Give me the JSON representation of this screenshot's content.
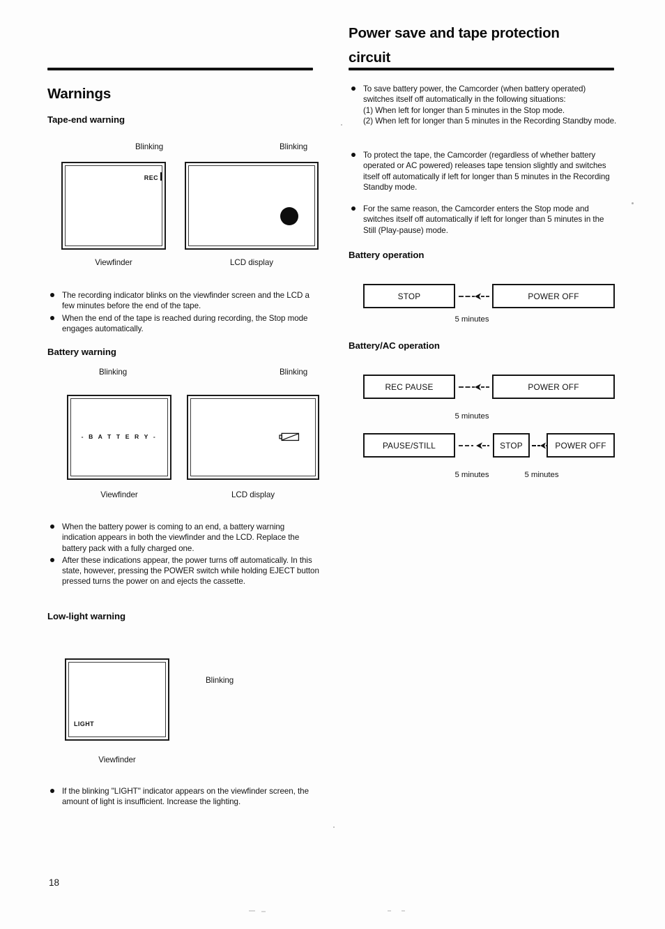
{
  "page": {
    "number": "18"
  },
  "left_column": {
    "heading": "Warnings",
    "sections": [
      {
        "title": "Tape-end warning",
        "figures": {
          "blinking_label_left": "Blinking",
          "blinking_label_right": "Blinking",
          "viewfinder_caption": "Viewfinder",
          "lcd_caption": "LCD display",
          "viewfinder_screen_text": "REC",
          "lcd_screen_icon": "record-dot-icon"
        },
        "bullets": [
          "The recording indicator blinks on the viewfinder screen and the LCD a few minutes before the end of the tape.",
          "When the end of the tape is reached during recording, the Stop mode engages automatically."
        ]
      },
      {
        "title": "Battery warning",
        "figures": {
          "blinking_label_left": "Blinking",
          "blinking_label_right": "Blinking",
          "viewfinder_caption": "Viewfinder",
          "lcd_caption": "LCD display",
          "viewfinder_screen_text": "- B A T T E R Y -",
          "lcd_screen_icon": "empty-battery-icon"
        },
        "bullets": [
          "When the battery power is coming to an end, a battery warning indication appears in both the viewfinder and the LCD. Replace the battery pack with a fully charged one.",
          "After these indications appear, the power turns off automatically. In this state, however, pressing the POWER switch while holding EJECT button pressed turns the power on and ejects the cassette."
        ]
      },
      {
        "title": "Low-light warning",
        "figures": {
          "blinking_label_right": "Blinking",
          "viewfinder_caption": "Viewfinder",
          "viewfinder_screen_text": "LIGHT"
        },
        "bullets": [
          "If the blinking \"LIGHT\" indicator appears on the viewfinder screen, the amount of light is insufficient. Increase the lighting."
        ]
      }
    ]
  },
  "right_column": {
    "heading_line1": "Power save and tape protection",
    "heading_line2": "circuit",
    "bullets": [
      {
        "text": "To save battery power, the Camcorder (when battery operated) switches itself off automatically in the following situations:",
        "sub": [
          "(1) When left for longer than 5 minutes in the Stop mode.",
          "(2) When left for longer than 5 minutes in the Recording Standby mode."
        ]
      },
      {
        "text": "To protect the tape, the Camcorder (regardless of whether battery operated or AC powered) releases tape tension slightly and switches itself off automatically if left for longer than 5 minutes in the Recording Standby mode.",
        "sub": []
      },
      {
        "text": "For the same reason, the Camcorder enters the Stop mode and switches itself off automatically if left for longer than 5 minutes in the Still (Play-pause) mode.",
        "sub": []
      }
    ],
    "diagrams": [
      {
        "title": "Battery operation",
        "rows": [
          {
            "boxes": [
              "STOP",
              "POWER OFF"
            ],
            "labels": [
              "5 minutes"
            ]
          }
        ]
      },
      {
        "title": "Battery/AC operation",
        "rows": [
          {
            "boxes": [
              "REC PAUSE",
              "POWER OFF"
            ],
            "labels": [
              "5 minutes"
            ]
          },
          {
            "boxes": [
              "PAUSE/STILL",
              "STOP",
              "POWER OFF"
            ],
            "labels": [
              "5 minutes",
              "5 minutes"
            ]
          }
        ]
      }
    ]
  }
}
